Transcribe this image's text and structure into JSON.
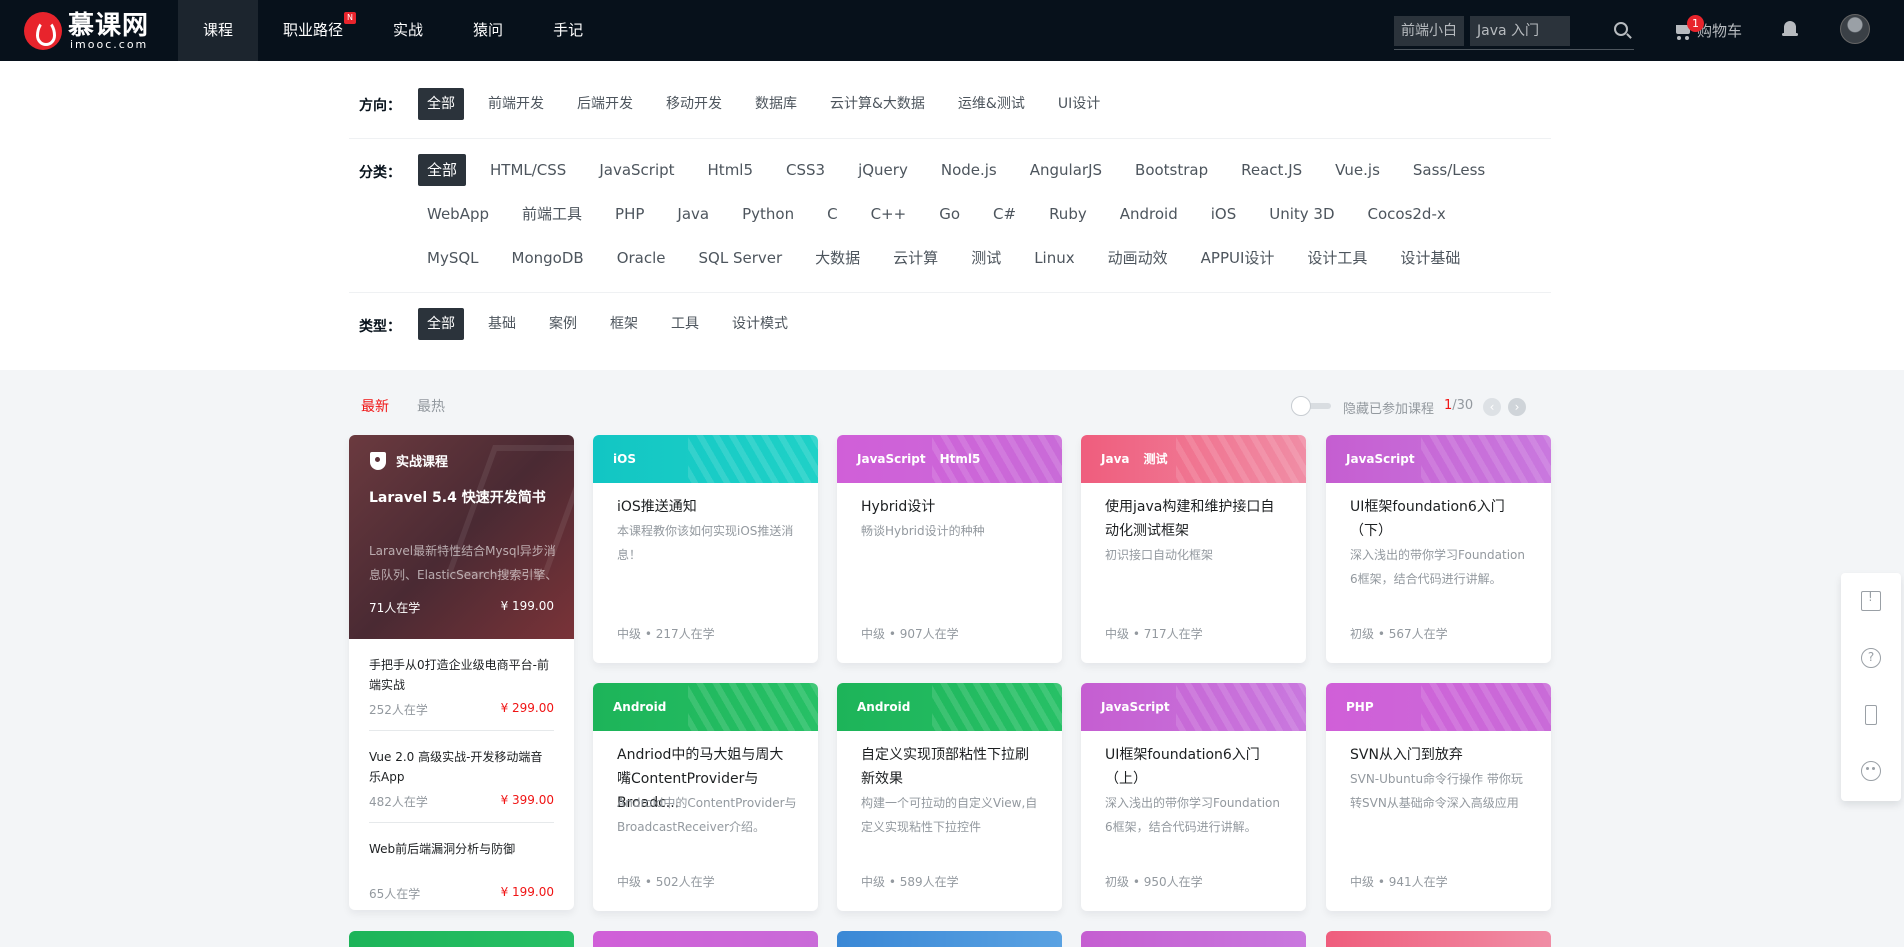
{
  "header": {
    "logo_name": "慕课网",
    "logo_sub": "imooc.com",
    "nav": [
      "课程",
      "职业路径",
      "实战",
      "猿问",
      "手记"
    ],
    "nav_badge": "N",
    "search_tags": [
      "前端小白",
      "Java 入门"
    ],
    "cart_label": "购物车",
    "cart_count": "1"
  },
  "filters": {
    "direction": {
      "label": "方向：",
      "items": [
        "全部",
        "前端开发",
        "后端开发",
        "移动开发",
        "数据库",
        "云计算&大数据",
        "运维&测试",
        "UI设计"
      ]
    },
    "category": {
      "label": "分类：",
      "items": [
        "全部",
        "HTML/CSS",
        "JavaScript",
        "Html5",
        "CSS3",
        "jQuery",
        "Node.js",
        "AngularJS",
        "Bootstrap",
        "React.JS",
        "Vue.js",
        "Sass/Less",
        "WebApp",
        "前端工具",
        "PHP",
        "Java",
        "Python",
        "C",
        "C++",
        "Go",
        "C#",
        "Ruby",
        "Android",
        "iOS",
        "Unity 3D",
        "Cocos2d-x",
        "MySQL",
        "MongoDB",
        "Oracle",
        "SQL Server",
        "大数据",
        "云计算",
        "测试",
        "Linux",
        "动画动效",
        "APPUI设计",
        "设计工具",
        "设计基础"
      ]
    },
    "type": {
      "label": "类型：",
      "items": [
        "全部",
        "基础",
        "案例",
        "框架",
        "工具",
        "设计模式"
      ]
    }
  },
  "sortbar": {
    "latest": "最新",
    "hottest": "最热",
    "hide_joined": "隐藏已参加课程",
    "page_current": "1",
    "page_total": "/30"
  },
  "featured": {
    "tag": "实战课程",
    "title": "Laravel 5.4 快速开发简书",
    "desc": "Laravel最新特性结合Mysql异步消息队列、ElasticSearch搜索引擎、",
    "learners": "71人在学",
    "price": "¥ 199.00",
    "list": [
      {
        "title": "手把手从0打造企业级电商平台-前端实战",
        "learners": "252人在学",
        "price": "¥ 299.00"
      },
      {
        "title": "Vue 2.0 高级实战-开发移动端音乐App",
        "learners": "482人在学",
        "price": "¥ 399.00"
      },
      {
        "title": "Web前后端漏洞分析与防御",
        "learners": "65人在学",
        "price": "¥ 199.00"
      }
    ]
  },
  "cards": [
    {
      "tags": [
        "iOS"
      ],
      "title": "iOS推送通知",
      "desc": "本课程教你该如何实现iOS推送消息！",
      "meta": "中级 • 217人在学",
      "color": "#12c6c4"
    },
    {
      "tags": [
        "JavaScript",
        "Html5"
      ],
      "title": "Hybrid设计",
      "desc": "畅谈Hybrid设计的种种",
      "meta": "中级 • 907人在学",
      "color": "#d05fd8"
    },
    {
      "tags": [
        "Java",
        "测试"
      ],
      "title": "使用java构建和维护接口自动化测试框架",
      "desc": "初识接口自动化框架",
      "meta": "中级 • 717人在学",
      "color": "#ef5d7d"
    },
    {
      "tags": [
        "JavaScript"
      ],
      "title": "UI框架foundation6入门（下）",
      "desc": "深入浅出的带你学习Foundation 6框架，结合代码进行讲解。",
      "meta": "初级 • 567人在学",
      "color": "#c55ed1"
    },
    {
      "tags": [
        "Android"
      ],
      "title": "Andriod中的马大姐与周大嘴ContentProvider与Broadc...",
      "desc": "Android中的ContentProvider与BroadcastReceiver介绍。",
      "meta": "中级 • 502人在学",
      "color": "#1db459"
    },
    {
      "tags": [
        "Android"
      ],
      "title": "自定义实现顶部粘性下拉刷新效果",
      "desc": "构建一个可拉动的自定义View,自定义实现粘性下拉控件",
      "meta": "中级 • 589人在学",
      "color": "#1db459"
    },
    {
      "tags": [
        "JavaScript"
      ],
      "title": "UI框架foundation6入门（上）",
      "desc": "深入浅出的带你学习Foundation 6框架，结合代码进行讲解。",
      "meta": "初级 • 950人在学",
      "color": "#c55ed1"
    },
    {
      "tags": [
        "PHP"
      ],
      "title": "SVN从入门到放弃",
      "desc": "SVN-Ubuntu命令行操作 带你玩转SVN从基础命令深入高级应用",
      "meta": "中级 • 941人在学",
      "color": "#c96bd8"
    }
  ]
}
